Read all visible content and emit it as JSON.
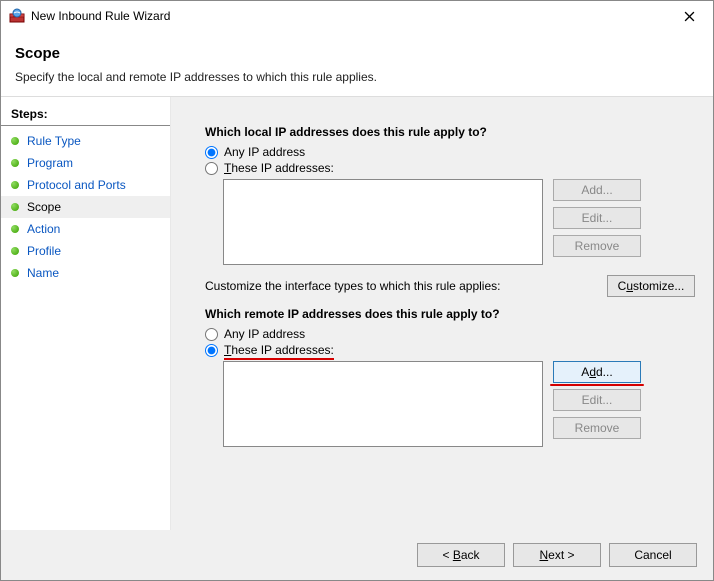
{
  "window": {
    "title": "New Inbound Rule Wizard"
  },
  "header": {
    "heading": "Scope",
    "description": "Specify the local and remote IP addresses to which this rule applies."
  },
  "sidebar": {
    "steps_label": "Steps:",
    "items": [
      {
        "label": "Rule Type",
        "current": false
      },
      {
        "label": "Program",
        "current": false
      },
      {
        "label": "Protocol and Ports",
        "current": false
      },
      {
        "label": "Scope",
        "current": true
      },
      {
        "label": "Action",
        "current": false
      },
      {
        "label": "Profile",
        "current": false
      },
      {
        "label": "Name",
        "current": false
      }
    ]
  },
  "local": {
    "question": "Which local IP addresses does this rule apply to?",
    "opt_any": "Any IP address",
    "opt_these_prefix": "T",
    "opt_these_rest": "hese IP addresses:",
    "selected": "any",
    "buttons": {
      "add": "Add...",
      "edit": "Edit...",
      "remove": "Remove"
    }
  },
  "interface": {
    "text": "Customize the interface types to which this rule applies:",
    "button": "Customize..."
  },
  "remote": {
    "question": "Which remote IP addresses does this rule apply to?",
    "opt_any": "Any IP address",
    "opt_these_prefix": "T",
    "opt_these_rest": "hese IP addresses:",
    "selected": "these",
    "buttons": {
      "add": "Add...",
      "edit": "Edit...",
      "remove": "Remove"
    }
  },
  "footer": {
    "back_prefix": "< ",
    "back_u": "B",
    "back_rest": "ack",
    "next_u": "N",
    "next_rest": "ext >",
    "cancel": "Cancel"
  }
}
